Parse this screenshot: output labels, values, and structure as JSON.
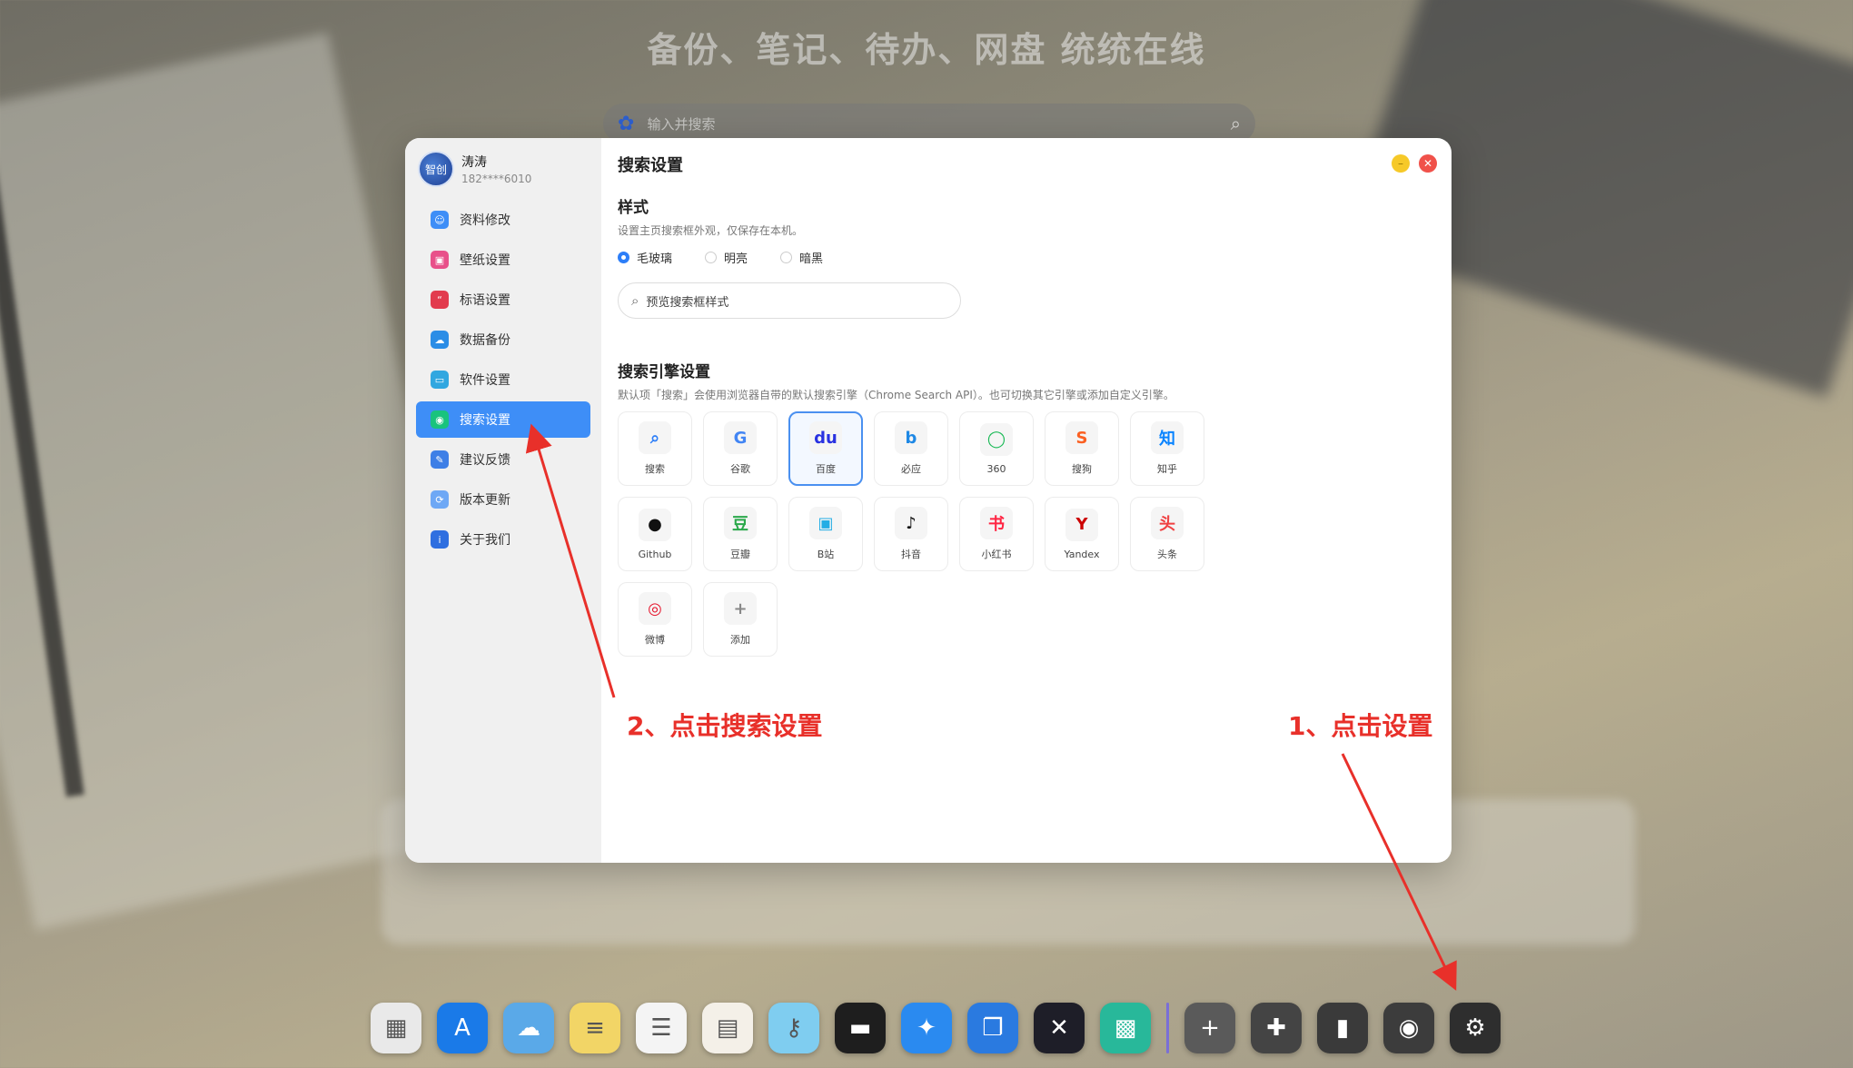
{
  "background": {
    "headline": "备份、笔记、待办、网盘 统统在线"
  },
  "search": {
    "placeholder": "输入并搜索"
  },
  "user": {
    "avatar_text": "智创",
    "name": "涛涛",
    "phone": "182****6010"
  },
  "sidebar": {
    "items": [
      {
        "label": "资料修改",
        "icon": "user-card-icon",
        "color": "#3e8ef7",
        "glyph": "☺"
      },
      {
        "label": "壁纸设置",
        "icon": "wallpaper-icon",
        "color": "#e8508a",
        "glyph": "▣"
      },
      {
        "label": "标语设置",
        "icon": "quote-icon",
        "color": "#e23b4e",
        "glyph": "“"
      },
      {
        "label": "数据备份",
        "icon": "cloud-icon",
        "color": "#2b8de6",
        "glyph": "☁"
      },
      {
        "label": "软件设置",
        "icon": "monitor-icon",
        "color": "#31a7e0",
        "glyph": "▭"
      },
      {
        "label": "搜索设置",
        "icon": "search-settings-icon",
        "color": "#19c37d",
        "glyph": "◉"
      },
      {
        "label": "建议反馈",
        "icon": "feedback-icon",
        "color": "#3e7fe6",
        "glyph": "✎"
      },
      {
        "label": "版本更新",
        "icon": "update-icon",
        "color": "#6ea8f5",
        "glyph": "⟳"
      },
      {
        "label": "关于我们",
        "icon": "info-icon",
        "color": "#2f6fe0",
        "glyph": "i"
      }
    ],
    "active_index": 5
  },
  "page": {
    "title": "搜索设置",
    "style": {
      "title": "样式",
      "desc": "设置主页搜索框外观，仅保存在本机。",
      "options": [
        "毛玻璃",
        "明亮",
        "暗黑"
      ],
      "selected": "毛玻璃",
      "preview_text": "预览搜索框样式"
    },
    "engines": {
      "title": "搜索引擎设置",
      "desc": "默认项「搜索」会使用浏览器自带的默认搜索引擎（Chrome Search API）。也可切换其它引擎或添加自定义引擎。",
      "items": [
        {
          "label": "搜索",
          "icon": "magnifier-icon",
          "glyph": "⌕",
          "color": "#2c7ef8"
        },
        {
          "label": "谷歌",
          "icon": "google-icon",
          "glyph": "G",
          "color": "#4285f4"
        },
        {
          "label": "百度",
          "icon": "baidu-icon",
          "glyph": "du",
          "color": "#2932e1"
        },
        {
          "label": "必应",
          "icon": "bing-icon",
          "glyph": "b",
          "color": "#1e88e5"
        },
        {
          "label": "360",
          "icon": "360-icon",
          "glyph": "◯",
          "color": "#19b955"
        },
        {
          "label": "搜狗",
          "icon": "sogou-icon",
          "glyph": "S",
          "color": "#fb6022"
        },
        {
          "label": "知乎",
          "icon": "zhihu-icon",
          "glyph": "知",
          "color": "#0a84ff"
        },
        {
          "label": "Github",
          "icon": "github-icon",
          "glyph": "●",
          "color": "#111111"
        },
        {
          "label": "豆瓣",
          "icon": "douban-icon",
          "glyph": "豆",
          "color": "#2aa84a"
        },
        {
          "label": "B站",
          "icon": "bilibili-icon",
          "glyph": "▣",
          "color": "#23ade5"
        },
        {
          "label": "抖音",
          "icon": "douyin-icon",
          "glyph": "♪",
          "color": "#111111"
        },
        {
          "label": "小红书",
          "icon": "xiaohongshu-icon",
          "glyph": "书",
          "color": "#ff2442"
        },
        {
          "label": "Yandex",
          "icon": "yandex-icon",
          "glyph": "Y",
          "color": "#cc0000"
        },
        {
          "label": "头条",
          "icon": "toutiao-icon",
          "glyph": "头",
          "color": "#f04142"
        },
        {
          "label": "微博",
          "icon": "weibo-icon",
          "glyph": "◎",
          "color": "#e6162d"
        },
        {
          "label": "添加",
          "icon": "plus-icon",
          "glyph": "+",
          "color": "#888888"
        }
      ],
      "selected": "百度"
    }
  },
  "annotations": {
    "step2": "2、点击搜索设置",
    "step1": "1、点击设置"
  },
  "dock": {
    "items": [
      {
        "icon": "launchpad-icon",
        "glyph": "▦",
        "color": "#e9e9e9"
      },
      {
        "icon": "app-store-icon",
        "glyph": "A",
        "color": "#1a7ae8"
      },
      {
        "icon": "cloud-drive-icon",
        "glyph": "☁",
        "color": "#5aa9e8"
      },
      {
        "icon": "notes-icon",
        "glyph": "≡",
        "color": "#f2d566"
      },
      {
        "icon": "reminders-icon",
        "glyph": "☰",
        "color": "#f4f4f4"
      },
      {
        "icon": "calendar-icon",
        "glyph": "▤",
        "color": "#f4f0e8"
      },
      {
        "icon": "passwords-icon",
        "glyph": "⚷",
        "color": "#7fcdf0"
      },
      {
        "icon": "wallet-icon",
        "glyph": "▬",
        "color": "#1e1e1e"
      },
      {
        "icon": "safari-icon",
        "glyph": "✦",
        "color": "#2a8af0"
      },
      {
        "icon": "files-icon",
        "glyph": "❐",
        "color": "#2a7ae0"
      },
      {
        "icon": "xmind-icon",
        "glyph": "✕",
        "color": "#1e1e28"
      },
      {
        "icon": "qrcode-icon",
        "glyph": "▩",
        "color": "#28b89a"
      },
      {
        "icon": "add-icon",
        "glyph": "+",
        "color": "#5a5a5a"
      },
      {
        "icon": "plugin-icon",
        "glyph": "✚",
        "color": "#444444"
      },
      {
        "icon": "brush-icon",
        "glyph": "▮",
        "color": "#3a3a3a"
      },
      {
        "icon": "camera-icon",
        "glyph": "◉",
        "color": "#3c3c3c"
      },
      {
        "icon": "settings-icon",
        "glyph": "⚙",
        "color": "#2e2e2e"
      }
    ]
  }
}
